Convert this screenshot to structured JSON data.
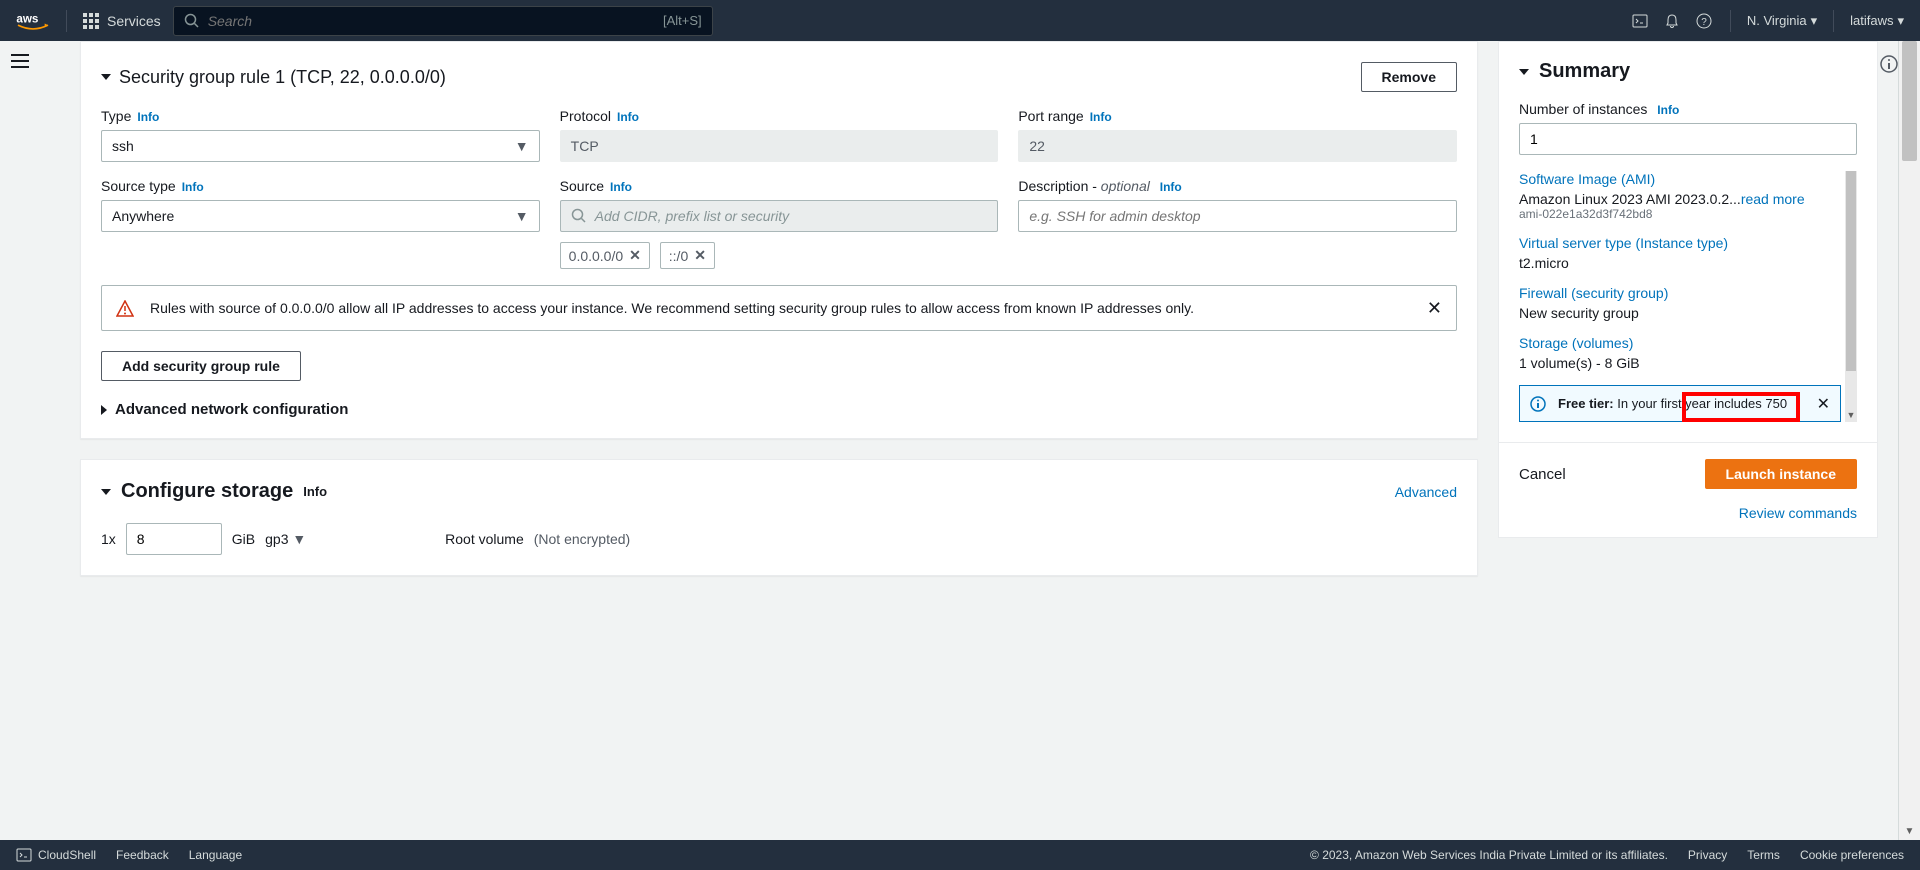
{
  "header": {
    "services_label": "Services",
    "search_placeholder": "Search",
    "search_kbd": "[Alt+S]",
    "region": "N. Virginia",
    "account": "latifaws"
  },
  "security_group": {
    "title": "Security group rule 1 (TCP, 22, 0.0.0.0/0)",
    "remove_label": "Remove",
    "type_label": "Type",
    "type_value": "ssh",
    "protocol_label": "Protocol",
    "protocol_value": "TCP",
    "port_label": "Port range",
    "port_value": "22",
    "source_type_label": "Source type",
    "source_type_value": "Anywhere",
    "source_label": "Source",
    "source_placeholder": "Add CIDR, prefix list or security",
    "source_chips": [
      "0.0.0.0/0",
      "::/0"
    ],
    "desc_label": "Description - ",
    "desc_optional": "optional",
    "desc_placeholder": "e.g. SSH for admin desktop",
    "warning": "Rules with source of 0.0.0.0/0 allow all IP addresses to access your instance. We recommend setting security group rules to allow access from known IP addresses only.",
    "add_rule_label": "Add security group rule",
    "advanced_label": "Advanced network configuration",
    "info_label": "Info"
  },
  "storage": {
    "title": "Configure storage",
    "info_label": "Info",
    "advanced_link": "Advanced",
    "count_prefix": "1x",
    "size_value": "8",
    "size_unit": "GiB",
    "vol_type": "gp3",
    "root_label": "Root volume",
    "encrypt_label": "(Not encrypted)"
  },
  "summary": {
    "title": "Summary",
    "num_instances_label": "Number of instances",
    "num_instances_value": "1",
    "info_label": "Info",
    "ami_link": "Software Image (AMI)",
    "ami_name": "Amazon Linux 2023 AMI 2023.0.2...",
    "ami_readmore": "read more",
    "ami_id": "ami-022e1a32d3f742bd8",
    "instance_type_link": "Virtual server type (Instance type)",
    "instance_type_value": "t2.micro",
    "firewall_link": "Firewall (security group)",
    "firewall_value": "New security group",
    "storage_link": "Storage (volumes)",
    "storage_value": "1 volume(s) - 8 GiB",
    "free_tier_label": "Free tier:",
    "free_tier_text": "In your first year includes 750",
    "cancel_label": "Cancel",
    "launch_label": "Launch instance",
    "review_label": "Review commands"
  },
  "footer": {
    "cloudshell": "CloudShell",
    "feedback": "Feedback",
    "language": "Language",
    "copyright": "© 2023, Amazon Web Services India Private Limited or its affiliates.",
    "privacy": "Privacy",
    "terms": "Terms",
    "cookies": "Cookie preferences"
  }
}
